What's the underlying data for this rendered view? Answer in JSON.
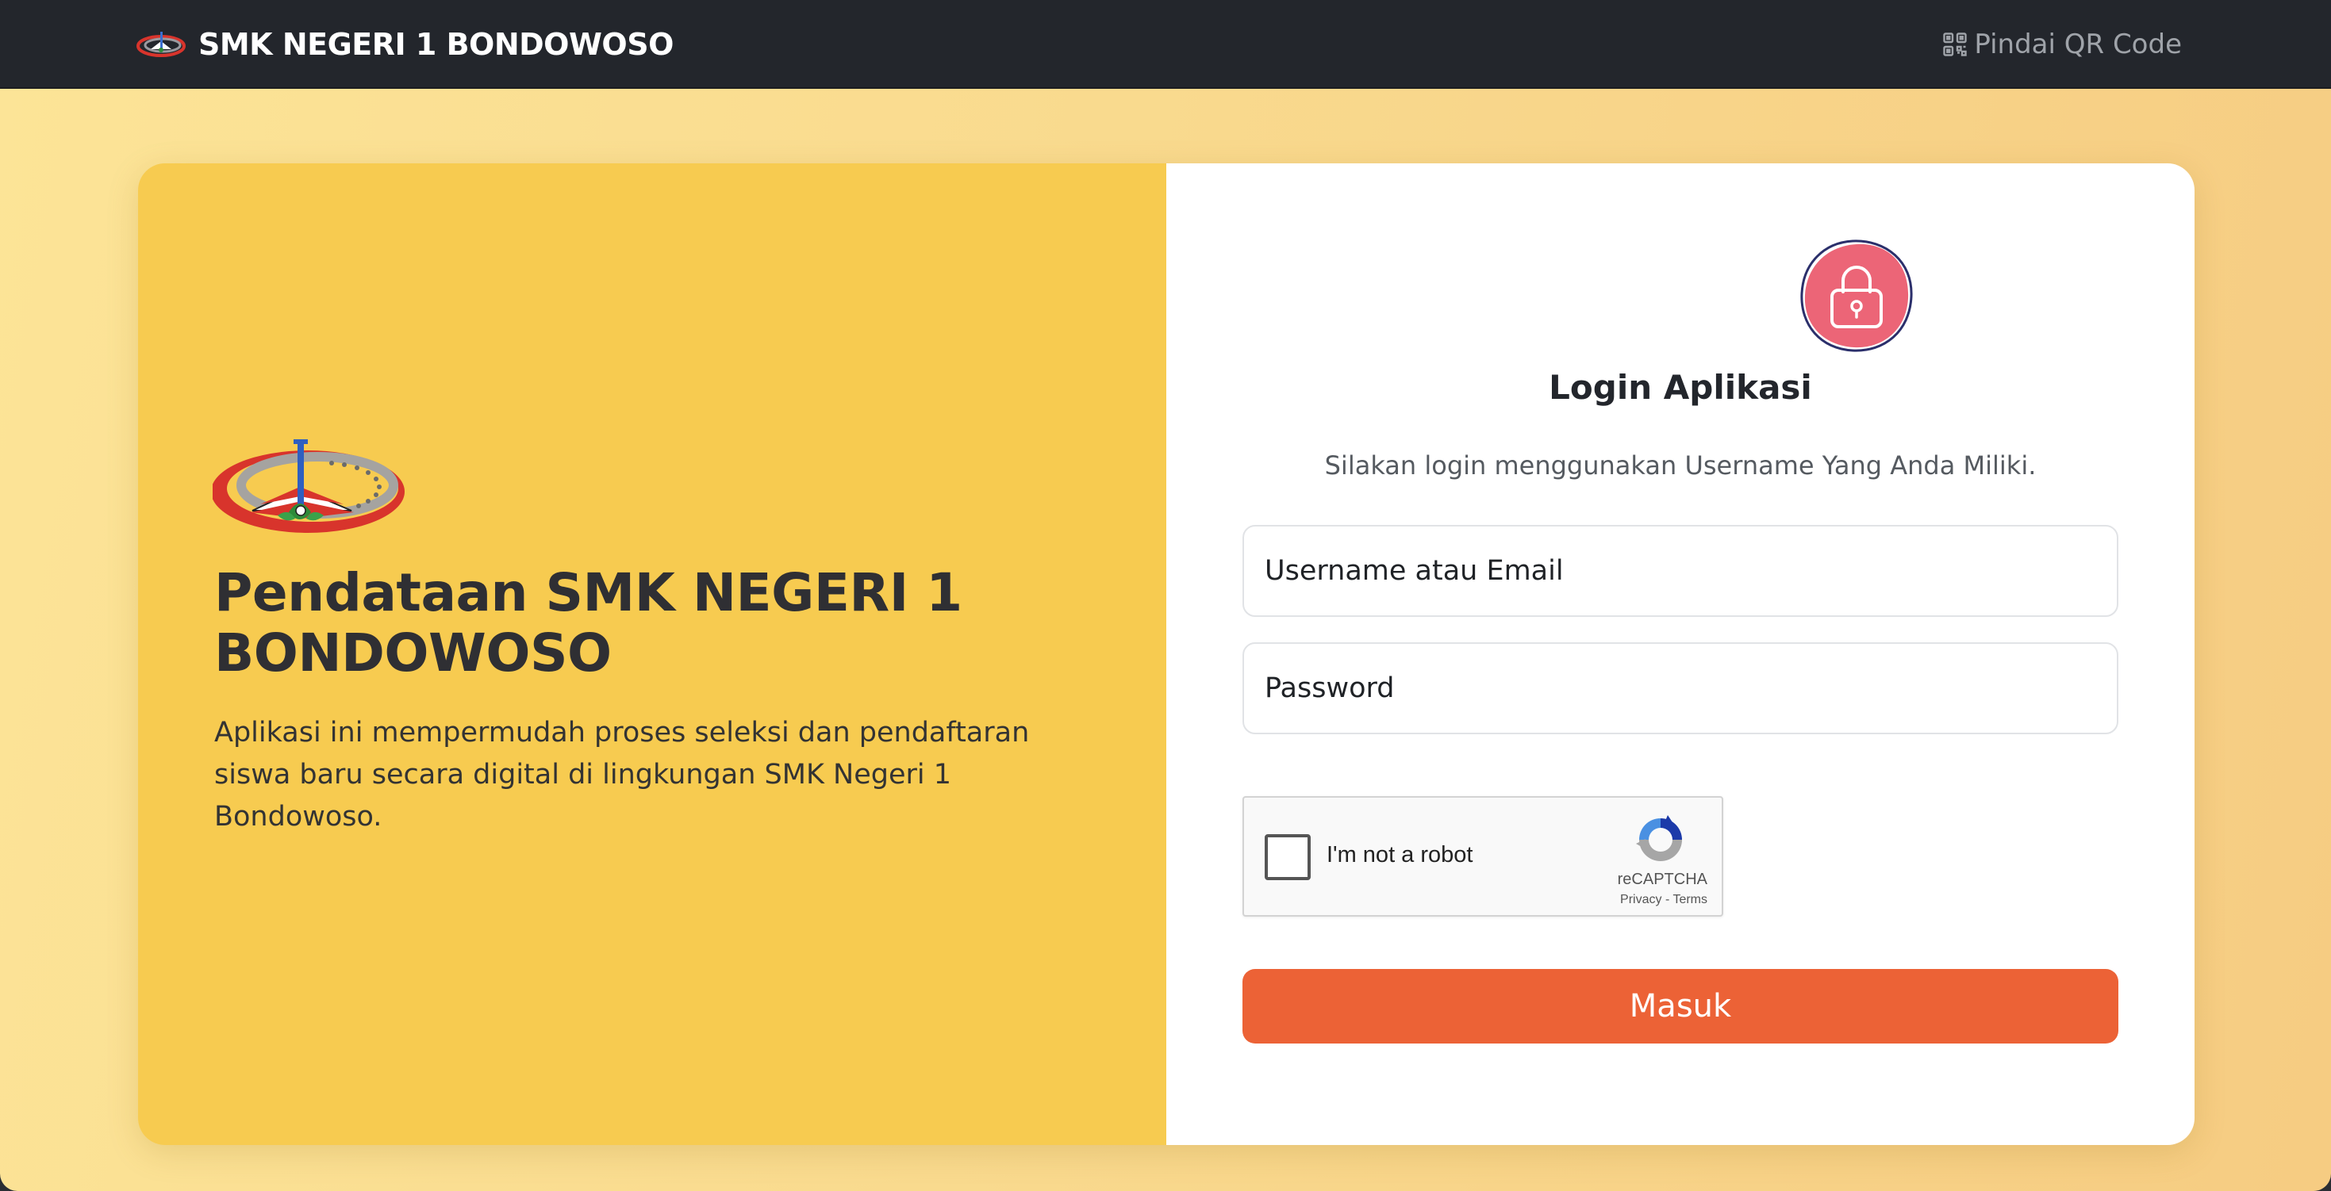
{
  "navbar": {
    "brand_name": "SMK NEGERI 1 BONDOWOSO",
    "brand_icon": "school-emblem-icon",
    "qr_label": "Pindai QR Code",
    "qr_icon": "qr-code-icon",
    "background": "#23262c"
  },
  "left_panel": {
    "title": "Pendataan SMK NEGERI 1 BONDOWOSO",
    "description": "Aplikasi ini mempermudah proses seleksi dan pendaftaran siswa baru secara digital di lingkungan SMK Negeri 1 Bondowoso.",
    "background": "#f7cb50"
  },
  "login": {
    "icon": "lock-icon",
    "title": "Login Aplikasi",
    "subtitle": "Silakan login menggunakan Username Yang Anda Miliki.",
    "username_placeholder": "Username atau Email",
    "username_value": "",
    "password_placeholder": "Password",
    "password_value": "",
    "submit_label": "Masuk",
    "submit_color": "#ec6236"
  },
  "recaptcha": {
    "label": "I'm not a robot",
    "brand": "reCAPTCHA",
    "privacy": "Privacy",
    "separator": " - ",
    "terms": "Terms",
    "checked": false
  }
}
